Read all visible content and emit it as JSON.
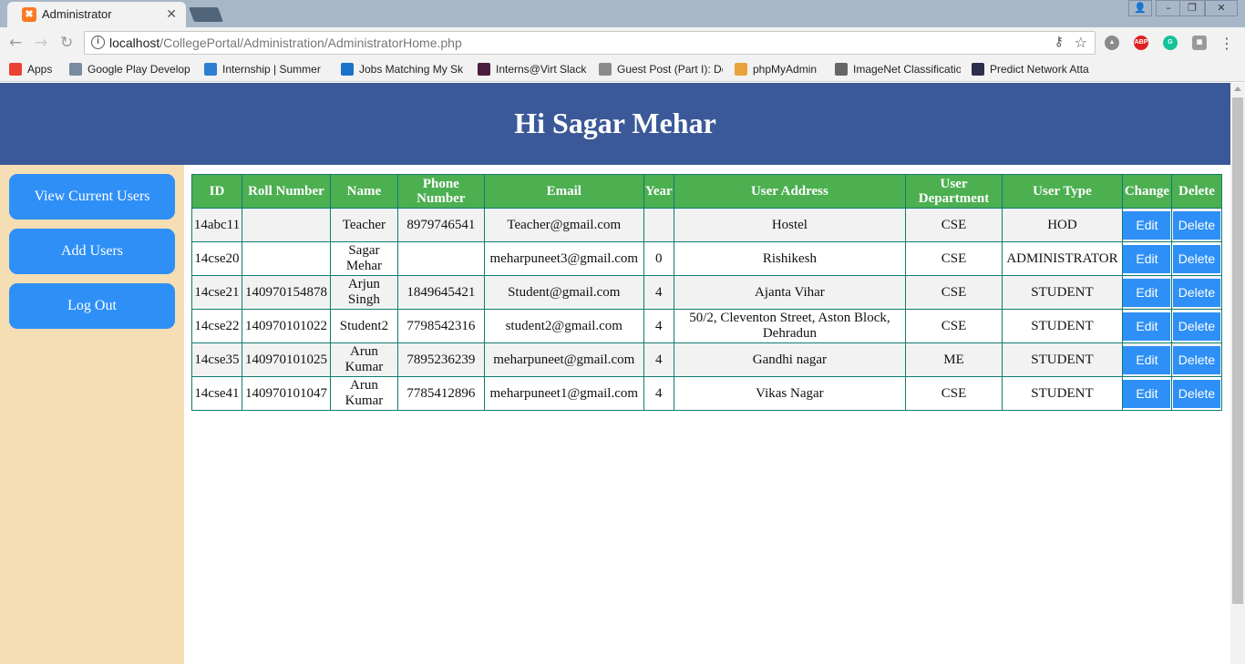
{
  "browser": {
    "tab_title": "Administrator",
    "tab_favicon": "xampp-icon",
    "url_host": "localhost",
    "url_path": "/CollegePortal/Administration/AdministratorHome.php",
    "bookmarks": [
      {
        "label": "Apps",
        "icon": "apps-grid-icon",
        "color": "#e94235"
      },
      {
        "label": "Google Play Develop",
        "icon": "play-icon",
        "color": "#7a8aa0"
      },
      {
        "label": "Internship | Summer",
        "icon": "is-icon",
        "color": "#2f7fd1"
      },
      {
        "label": "Jobs Matching My Sk",
        "icon": "angellist-icon",
        "color": "#1a73c9"
      },
      {
        "label": "Interns@Virt Slack",
        "icon": "slack-icon",
        "color": "#4a1d3f"
      },
      {
        "label": "Guest Post (Part I): De",
        "icon": "n-icon",
        "color": "#8a8a8a"
      },
      {
        "label": "phpMyAdmin",
        "icon": "phpmyadmin-icon",
        "color": "#e9a23b"
      },
      {
        "label": "ImageNet Classificatio",
        "icon": "imagenet-icon",
        "color": "#666666"
      },
      {
        "label": "Predict Network Atta",
        "icon": "h-icon",
        "color": "#2d2d4d"
      }
    ]
  },
  "header": {
    "greeting": "Hi Sagar Mehar"
  },
  "sidebar": {
    "items": [
      {
        "label": "View Current Users"
      },
      {
        "label": "Add Users"
      },
      {
        "label": "Log Out"
      }
    ]
  },
  "table": {
    "headers": [
      "ID",
      "Roll Number",
      "Name",
      "Phone Number",
      "Email",
      "Year",
      "User Address",
      "User Department",
      "User Type",
      "Change",
      "Delete"
    ],
    "edit_label": "Edit",
    "delete_label": "Delete",
    "rows": [
      {
        "id": "14abc11",
        "roll": "",
        "name": "Teacher",
        "phone": "8979746541",
        "email": "Teacher@gmail.com",
        "year": "",
        "address": "Hostel",
        "dept": "CSE",
        "type": "HOD"
      },
      {
        "id": "14cse20",
        "roll": "",
        "name": "Sagar Mehar",
        "phone": "",
        "email": "meharpuneet3@gmail.com",
        "year": "0",
        "address": "Rishikesh",
        "dept": "CSE",
        "type": "ADMINISTRATOR"
      },
      {
        "id": "14cse21",
        "roll": "140970154878",
        "name": "Arjun Singh",
        "phone": "1849645421",
        "email": "Student@gmail.com",
        "year": "4",
        "address": "Ajanta Vihar",
        "dept": "CSE",
        "type": "STUDENT"
      },
      {
        "id": "14cse22",
        "roll": "140970101022",
        "name": "Student2",
        "phone": "7798542316",
        "email": "student2@gmail.com",
        "year": "4",
        "address": "50/2, Cleventon Street, Aston Block, Dehradun",
        "dept": "CSE",
        "type": "STUDENT"
      },
      {
        "id": "14cse35",
        "roll": "140970101025",
        "name": "Arun Kumar",
        "phone": "7895236239",
        "email": "meharpuneet@gmail.com",
        "year": "4",
        "address": "Gandhi nagar",
        "dept": "ME",
        "type": "STUDENT"
      },
      {
        "id": "14cse41",
        "roll": "140970101047",
        "name": "Arun Kumar",
        "phone": "7785412896",
        "email": "meharpuneet1@gmail.com",
        "year": "4",
        "address": "Vikas Nagar",
        "dept": "CSE",
        "type": "STUDENT"
      }
    ]
  },
  "colors": {
    "header_bg": "#3b5998",
    "sidebar_bg": "#f5deb3",
    "button_bg": "#2e8ff7",
    "table_header_bg": "#4caf50",
    "table_border": "#0e7d73"
  }
}
